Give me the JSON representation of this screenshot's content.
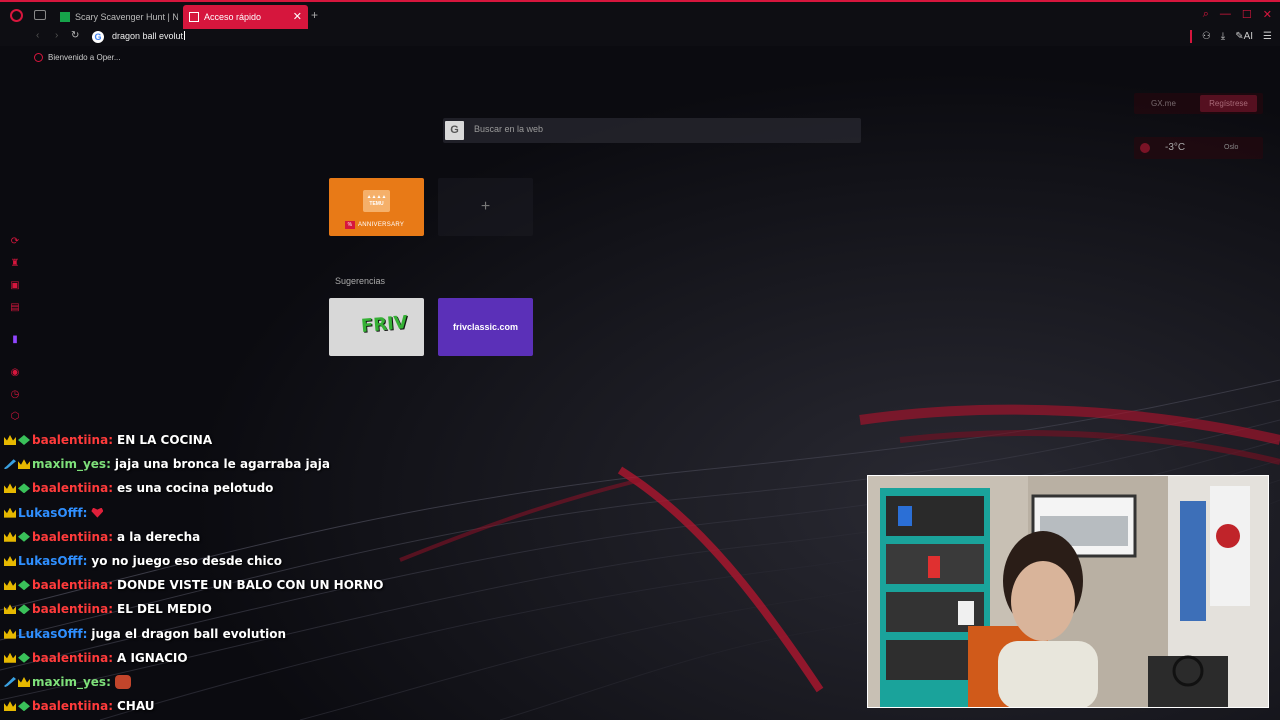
{
  "tabs": [
    {
      "label": "Scary Scavenger Hunt | Ne",
      "active": false
    },
    {
      "label": "Acceso rápido",
      "active": true
    }
  ],
  "address": {
    "value": "dragon ball evolut"
  },
  "bookmarks": [
    {
      "label": "Bienvenido a Oper..."
    }
  ],
  "speed_dial": {
    "search_placeholder": "Buscar en la web",
    "temu_sub": "ANNIVERSARY",
    "temu_logo": "TEMU",
    "add_symbol": "+",
    "suggestions_label": "Sugerencias",
    "friv_logo": "FRIV",
    "frivclassic_label": "frivclassic.com"
  },
  "widgets": {
    "gx_me": "GX.me",
    "register": "Regístrese",
    "temperature": "-3°C",
    "city": "Oslo"
  },
  "chat": [
    {
      "badges": [
        "crown",
        "gem"
      ],
      "user": "baalentiina",
      "user_class": "baal",
      "text": "EN LA COCINA"
    },
    {
      "badges": [
        "sword",
        "crown"
      ],
      "user": "maxim_yes",
      "user_class": "maxim",
      "text": "jaja una bronca le agarraba jaja"
    },
    {
      "badges": [
        "crown",
        "gem"
      ],
      "user": "baalentiina",
      "user_class": "baal",
      "text": "es una cocina pelotudo"
    },
    {
      "badges": [
        "crown"
      ],
      "user": "LukasOfff",
      "user_class": "lukas",
      "text": "",
      "emote": "heart"
    },
    {
      "badges": [
        "crown",
        "gem"
      ],
      "user": "baalentiina",
      "user_class": "baal",
      "text": "a la derecha"
    },
    {
      "badges": [
        "crown"
      ],
      "user": "LukasOfff",
      "user_class": "lukas",
      "text": "yo no juego eso desde chico"
    },
    {
      "badges": [
        "crown",
        "gem"
      ],
      "user": "baalentiina",
      "user_class": "baal",
      "text": "DONDE VISTE UN BALO CON UN HORNO"
    },
    {
      "badges": [
        "crown",
        "gem"
      ],
      "user": "baalentiina",
      "user_class": "baal",
      "text": "EL DEL MEDIO"
    },
    {
      "badges": [
        "crown"
      ],
      "user": "LukasOfff",
      "user_class": "lukas",
      "text": "juga el dragon ball evolution"
    },
    {
      "badges": [
        "crown",
        "gem"
      ],
      "user": "baalentiina",
      "user_class": "baal",
      "text": "A IGNACIO"
    },
    {
      "badges": [
        "sword",
        "crown"
      ],
      "user": "maxim_yes",
      "user_class": "maxim",
      "text": "",
      "emote": "emote"
    },
    {
      "badges": [
        "crown",
        "gem"
      ],
      "user": "baalentiina",
      "user_class": "baal",
      "text": "CHAU"
    }
  ],
  "colors": {
    "accent": "#d6163d",
    "baal": "#ff3b3b",
    "maxim": "#7ee07a",
    "lukas": "#2f8fff"
  }
}
